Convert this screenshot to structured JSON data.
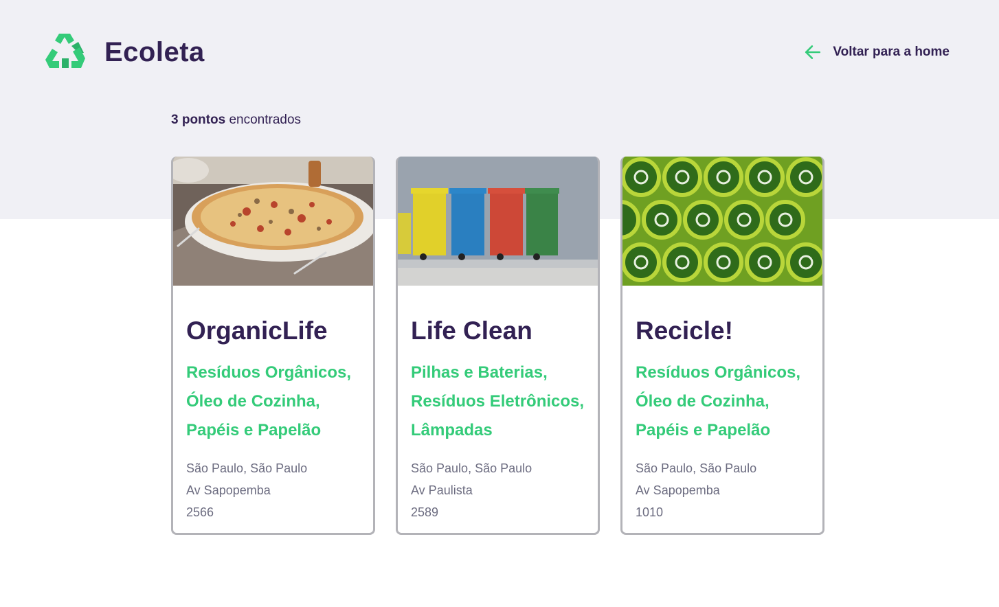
{
  "header": {
    "brand_name": "Ecoleta",
    "back_label": "Voltar para a home",
    "logo_icon": "recycle-icon",
    "back_icon": "arrow-left-icon"
  },
  "summary": {
    "count_strong": "3 pontos",
    "count_rest": " encontrados"
  },
  "colors": {
    "primary": "#34cb79",
    "title": "#322153",
    "text": "#6c6c80",
    "background": "#f0f0f5"
  },
  "points": [
    {
      "name": "OrganicLife",
      "image": "pizza-photo",
      "items": [
        "Resíduos Orgânicos,",
        "Óleo de Cozinha,",
        "Papéis e Papelão"
      ],
      "city_uf": "São Paulo, São Paulo",
      "street": "Av Sapopemba",
      "number": "2566"
    },
    {
      "name": "Life Clean",
      "image": "bins-photo",
      "items": [
        "Pilhas e Baterias,",
        "Resíduos Eletrônicos,",
        "Lâmpadas"
      ],
      "city_uf": "São Paulo, São Paulo",
      "street": "Av Paulista",
      "number": "2589"
    },
    {
      "name": "Recicle!",
      "image": "bottles-photo",
      "items": [
        "Resíduos Orgânicos,",
        "Óleo de Cozinha,",
        "Papéis e Papelão"
      ],
      "city_uf": "São Paulo, São Paulo",
      "street": "Av Sapopemba",
      "number": "1010"
    }
  ]
}
